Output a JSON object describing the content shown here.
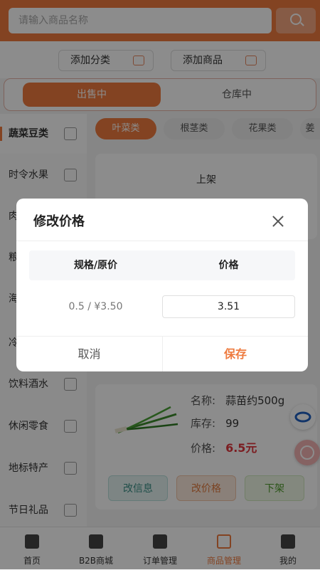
{
  "search": {
    "placeholder": "请输入商品名称"
  },
  "actions": {
    "add_category": "添加分类",
    "add_product": "添加商品"
  },
  "tabs": {
    "on_sale": "出售中",
    "warehouse": "仓库中"
  },
  "sidebar": {
    "items": [
      {
        "label": "蔬菜豆类"
      },
      {
        "label": "时令水果"
      },
      {
        "label": "肉"
      },
      {
        "label": "粮"
      },
      {
        "label": "海"
      },
      {
        "label": "冷"
      },
      {
        "label": "饮料酒水"
      },
      {
        "label": "休闲零食"
      },
      {
        "label": "地标特产"
      },
      {
        "label": "节日礼品"
      }
    ]
  },
  "chips": [
    {
      "label": "叶菜类"
    },
    {
      "label": "根茎类"
    },
    {
      "label": "花果类"
    },
    {
      "label": "姜"
    }
  ],
  "card_top": {
    "shelf_label": "上架"
  },
  "product": {
    "name_key": "名称:",
    "name_val": "蒜苗约500g",
    "stock_key": "库存:",
    "stock_val": "99",
    "price_key": "价格:",
    "price_val": "6.5元",
    "btn_edit_info": "改信息",
    "btn_edit_price": "改价格",
    "btn_unlist": "下架"
  },
  "tabbar": [
    {
      "label": "首页"
    },
    {
      "label": "B2B商城"
    },
    {
      "label": "订单管理"
    },
    {
      "label": "商品管理"
    },
    {
      "label": "我的"
    }
  ],
  "modal": {
    "title": "修改价格",
    "col_spec": "规格/原价",
    "col_price": "价格",
    "spec_value": "0.5 / ¥3.50",
    "price_value": "3.51",
    "cancel": "取消",
    "save": "保存"
  },
  "colors": {
    "accent": "#ee7a3e",
    "price_red": "#e0353d"
  }
}
